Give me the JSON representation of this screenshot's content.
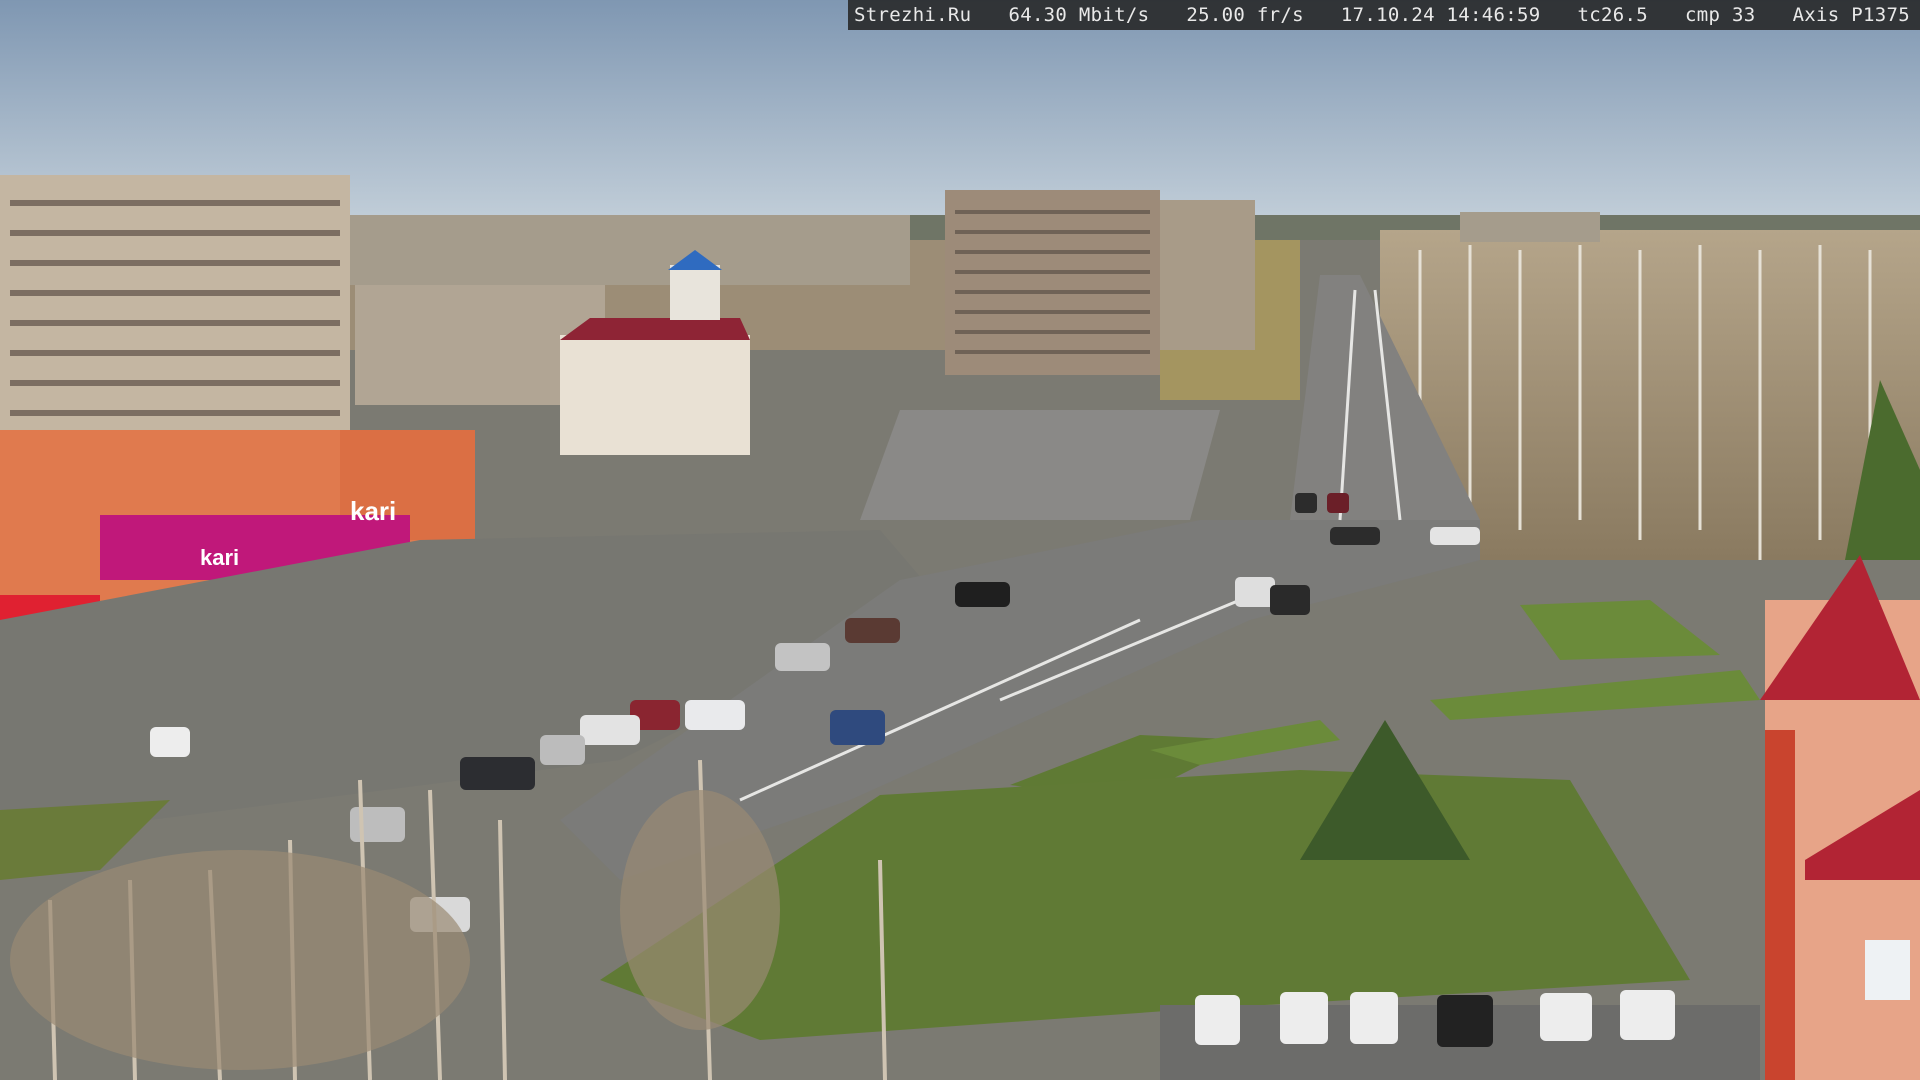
{
  "osd": {
    "site": "Strezhi.Ru",
    "bitrate": "64.30 Mbit/s",
    "framerate": "25.00 fr/s",
    "datetime": "17.10.24 14:46:59",
    "temperature": "tc26.5",
    "compression": "cmp 33",
    "camera_model": "Axis P1375"
  },
  "signage": {
    "store_logo": "kari",
    "store_banner": "kari"
  },
  "colors": {
    "sky_top": "#7f97b2",
    "sky_horizon": "#c4d0da",
    "asphalt": "#6f6f6d",
    "grass": "#5f7a34",
    "kari_magenta": "#c0187a",
    "building_orange": "#e07a4e",
    "roof_red": "#a51c2a"
  }
}
